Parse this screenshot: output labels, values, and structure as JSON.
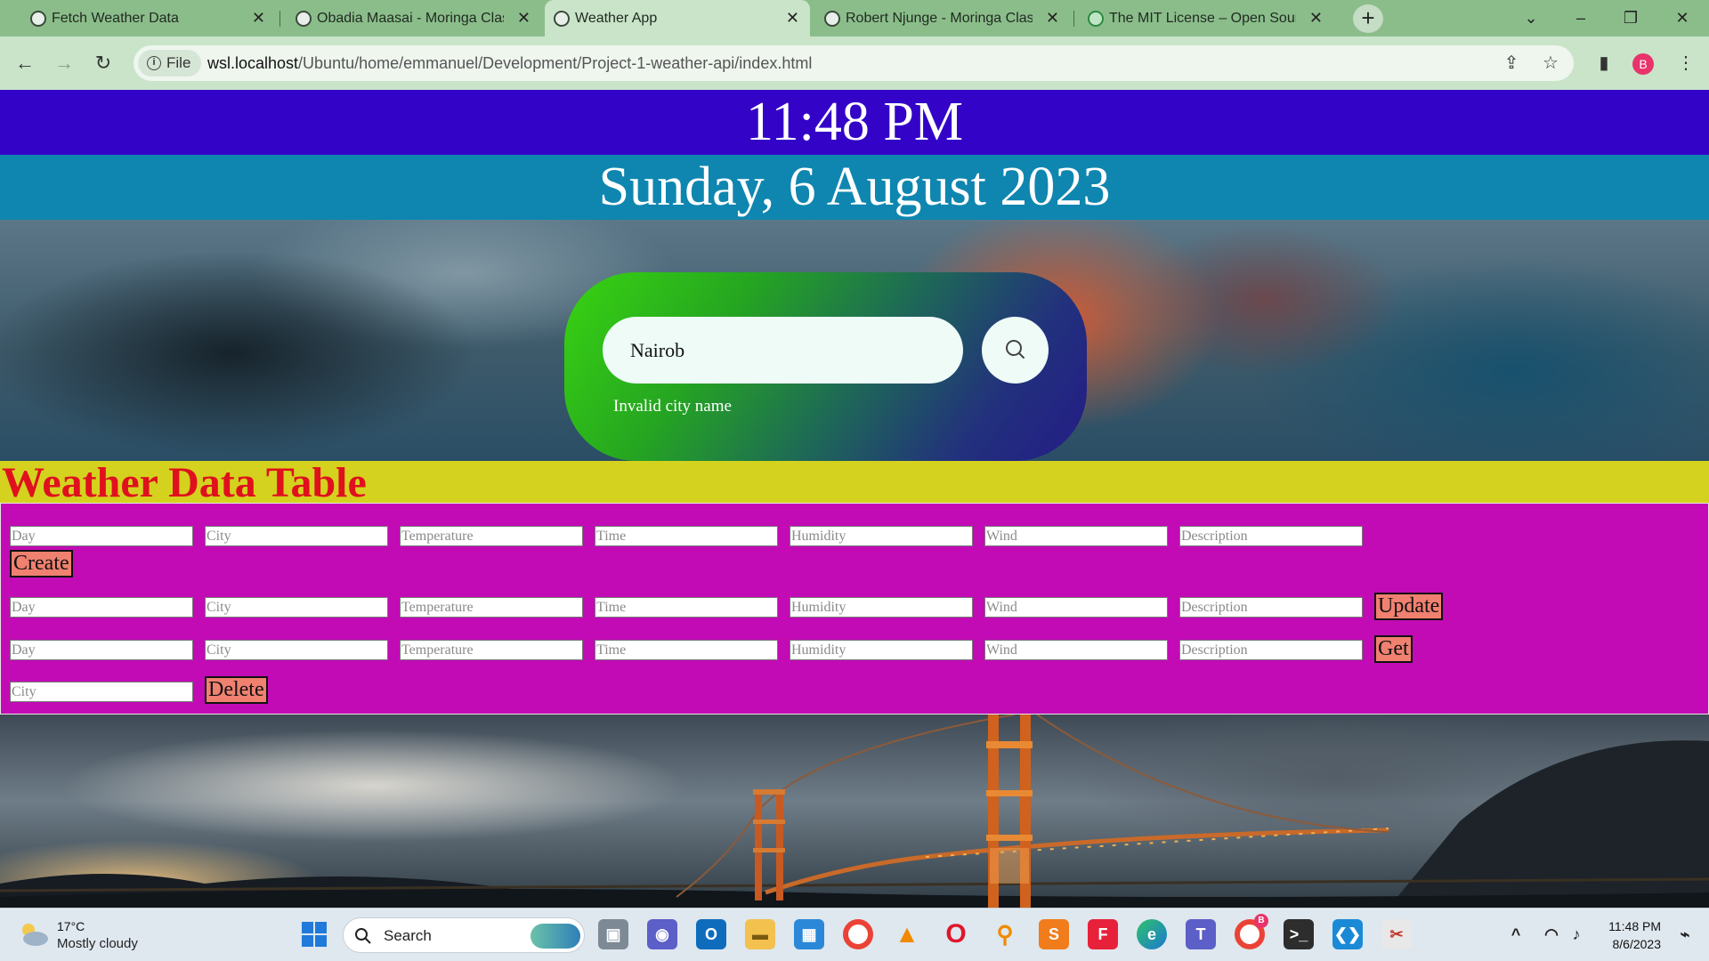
{
  "browser": {
    "tabs": [
      {
        "label": "Fetch Weather Data",
        "active": false
      },
      {
        "label": "Obadia Maasai - Moringa Class",
        "active": false
      },
      {
        "label": "Weather App",
        "active": true
      },
      {
        "label": "Robert Njunge - Moringa Class",
        "active": false
      },
      {
        "label": "The MIT License – Open Source",
        "active": false
      }
    ],
    "file_chip": "File",
    "url_host": "wsl.localhost",
    "url_path": "/Ubuntu/home/emmanuel/Development/Project-1-weather-api/index.html",
    "profile_initial": "B"
  },
  "page": {
    "time": "11:48 PM",
    "date": "Sunday, 6 August 2023",
    "search": {
      "value": "Nairob",
      "error": "Invalid city name"
    },
    "table_title": "Weather Data Table",
    "field_placeholders": {
      "day": "Day",
      "city": "City",
      "temperature": "Temperature",
      "time": "Time",
      "humidity": "Humidity",
      "wind": "Wind",
      "description": "Description"
    },
    "buttons": {
      "create": "Create",
      "update": "Update",
      "get": "Get",
      "delete": "Delete"
    }
  },
  "taskbar": {
    "weather_temp": "17°C",
    "weather_desc": "Mostly cloudy",
    "search_label": "Search",
    "clock_time": "11:48 PM",
    "clock_date": "8/6/2023",
    "chrome_badge": "B"
  },
  "colors": {
    "time_bar": "#3304c8",
    "date_bar": "#0f86b0",
    "title_bar": "#d4d21e",
    "title_text": "#e0101e",
    "table_bg": "#c20bb5",
    "button_bg": "#f08070"
  }
}
